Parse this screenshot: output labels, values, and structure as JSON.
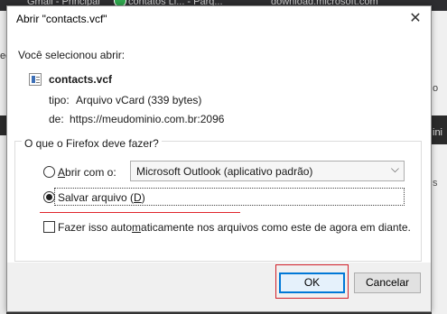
{
  "background": {
    "tabs": [
      "Gmail - Principal",
      "contatos Li... - Parq...",
      "download.microsoft.com"
    ],
    "left_fragment": "eg",
    "right_fragments": [
      "o",
      "ini",
      "s"
    ]
  },
  "dialog": {
    "title": "Abrir \"contacts.vcf\"",
    "close_glyph": "✕",
    "intro": "Você selecionou abrir:",
    "file_name": "contacts.vcf",
    "type_label": "tipo:",
    "type_value": "Arquivo vCard (339 bytes)",
    "from_label": "de:",
    "from_value": "https://meudominio.com.br:2096",
    "group_title": "O que o Firefox deve fazer?",
    "open_with": {
      "prefix": "",
      "accel": "A",
      "rest": "brir com o:",
      "checked": false
    },
    "app_select": {
      "value": "Microsoft Outlook (aplicativo padrão)",
      "chevron": "⌵"
    },
    "save_file": {
      "text": "Salvar arquivo (",
      "accel": "D",
      "suffix": ")",
      "checked": true
    },
    "remember": {
      "before": "Fazer isso auto",
      "accel": "m",
      "after": "aticamente nos arquivos como este de agora em diante.",
      "checked": false
    },
    "buttons": {
      "ok": "OK",
      "cancel": "Cancelar"
    },
    "colors": {
      "highlight_red": "#d1202a",
      "focus_blue": "#0078d7"
    }
  }
}
